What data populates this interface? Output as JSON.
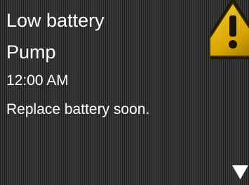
{
  "alert": {
    "title": "Low battery",
    "source": "Pump",
    "time": "12:00 AM",
    "message": "Replace battery soon."
  },
  "icons": {
    "alert_icon": "warning-triangle-icon",
    "scroll": "down-arrow-icon"
  },
  "colors": {
    "background": "#2a2a2a",
    "text": "#ffffff",
    "warning_fill": "#e0b000",
    "warning_outline": "#2a2000"
  }
}
